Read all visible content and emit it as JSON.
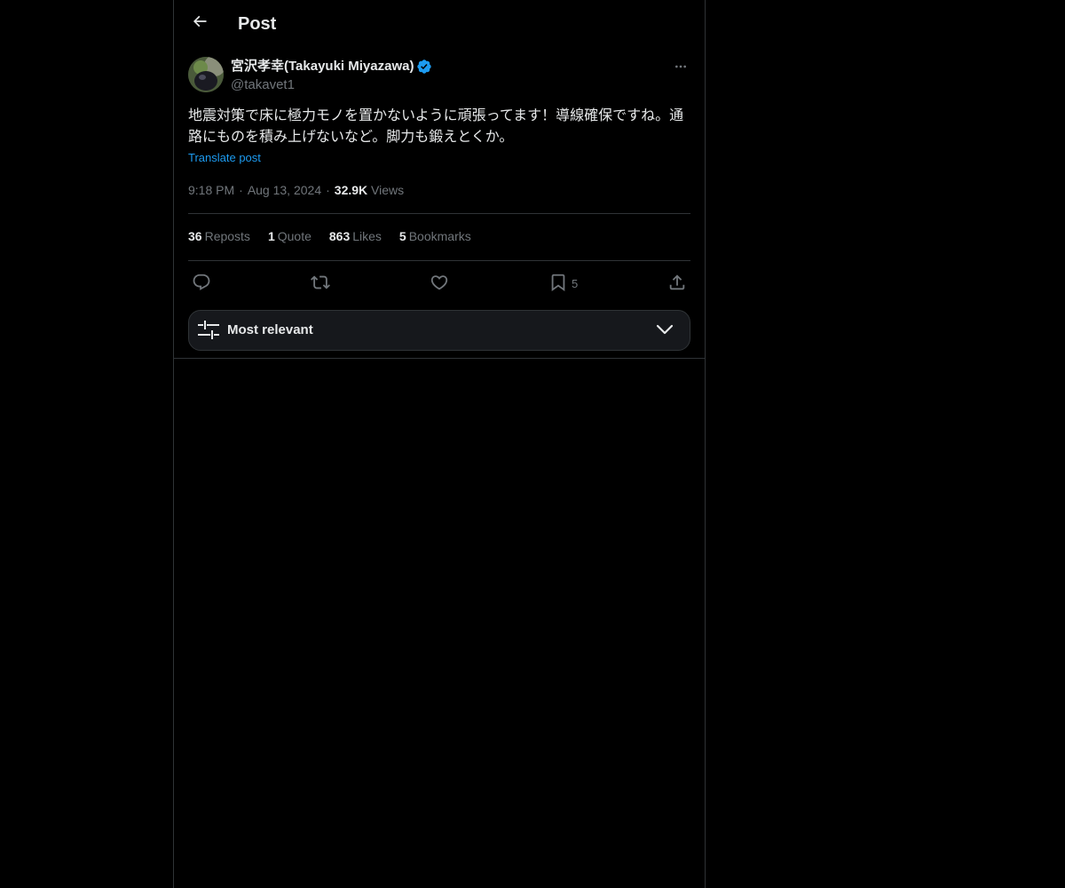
{
  "header": {
    "title": "Post"
  },
  "post": {
    "author": {
      "display_name": "宮沢孝幸(Takayuki Miyazawa)",
      "handle": "@takavet1",
      "verified": true
    },
    "text": "地震対策で床に極力モノを置かないように頑張ってます！導線確保ですね。通路にものを積み上げないなど。脚力も鍛えとくか。",
    "translate_label": "Translate post",
    "time": "9:18 PM",
    "date": "Aug 13, 2024",
    "separator": "·",
    "views_count": "32.9K",
    "views_label": "Views"
  },
  "stats": {
    "reposts": {
      "count": "36",
      "label": "Reposts"
    },
    "quotes": {
      "count": "1",
      "label": "Quote"
    },
    "likes": {
      "count": "863",
      "label": "Likes"
    },
    "bookmarks": {
      "count": "5",
      "label": "Bookmarks"
    }
  },
  "actions": {
    "reply_icon": "reply-icon",
    "repost_icon": "repost-icon",
    "like_icon": "heart-icon",
    "bookmark_icon": "bookmark-icon",
    "bookmark_count": "5",
    "share_icon": "share-icon"
  },
  "sort": {
    "label": "Most relevant"
  },
  "colors": {
    "background": "#000000",
    "text_primary": "#e7e9ea",
    "text_secondary": "#71767b",
    "accent": "#1d9bf0",
    "border": "#2f3336",
    "sort_bg": "#16181c"
  }
}
